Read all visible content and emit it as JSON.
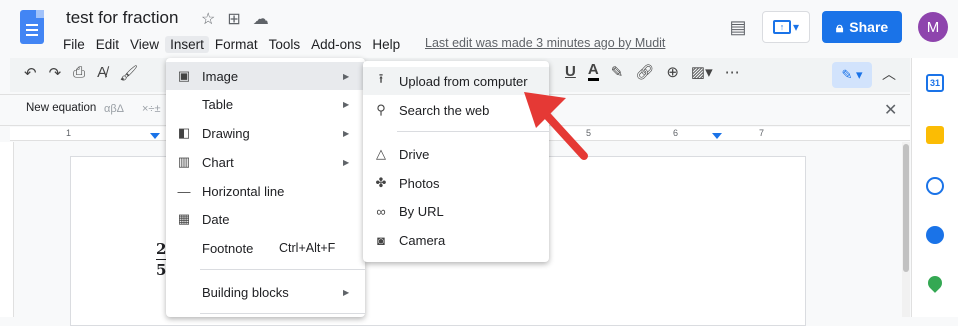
{
  "doc": {
    "title": "test for fraction",
    "last_edit": "Last edit was made 3 minutes ago by Mudit"
  },
  "menubar": {
    "items": [
      "File",
      "Edit",
      "View",
      "Insert",
      "Format",
      "Tools",
      "Add-ons",
      "Help"
    ],
    "active": "Insert"
  },
  "header": {
    "share_label": "Share",
    "avatar_initial": "M"
  },
  "equation_bar": {
    "label": "New equation",
    "symbols_greek": "αβΔ",
    "symbols_ops": "×÷±"
  },
  "ruler": {
    "numbers": [
      "1",
      "5",
      "6",
      "7"
    ]
  },
  "document_body": {
    "fraction_numerator": "2",
    "fraction_denominator": "5"
  },
  "insert_menu": {
    "items": [
      {
        "label": "Image",
        "icon": "image-icon",
        "has_submenu": true,
        "hover": true
      },
      {
        "label": "Table",
        "icon": "",
        "has_submenu": true
      },
      {
        "label": "Drawing",
        "icon": "drawing-icon",
        "has_submenu": true
      },
      {
        "label": "Chart",
        "icon": "chart-icon",
        "has_submenu": true
      },
      {
        "label": "Horizontal line",
        "icon": "horizontal-line-icon",
        "has_submenu": false
      },
      {
        "label": "Date",
        "icon": "calendar-icon",
        "has_submenu": false
      },
      {
        "label": "Footnote",
        "icon": "",
        "shortcut": "Ctrl+Alt+F"
      },
      {
        "label": "Building blocks",
        "icon": "",
        "has_submenu": true
      }
    ]
  },
  "image_submenu": {
    "items": [
      {
        "label": "Upload from computer",
        "icon": "upload-icon"
      },
      {
        "label": "Search the web",
        "icon": "search-icon"
      },
      {
        "label": "Drive",
        "icon": "drive-icon"
      },
      {
        "label": "Photos",
        "icon": "photos-icon"
      },
      {
        "label": "By URL",
        "icon": "link-icon"
      },
      {
        "label": "Camera",
        "icon": "camera-icon"
      }
    ]
  },
  "colors": {
    "accent": "#1a73e8",
    "avatar": "#8e44ad",
    "pointer": "#e53935"
  }
}
